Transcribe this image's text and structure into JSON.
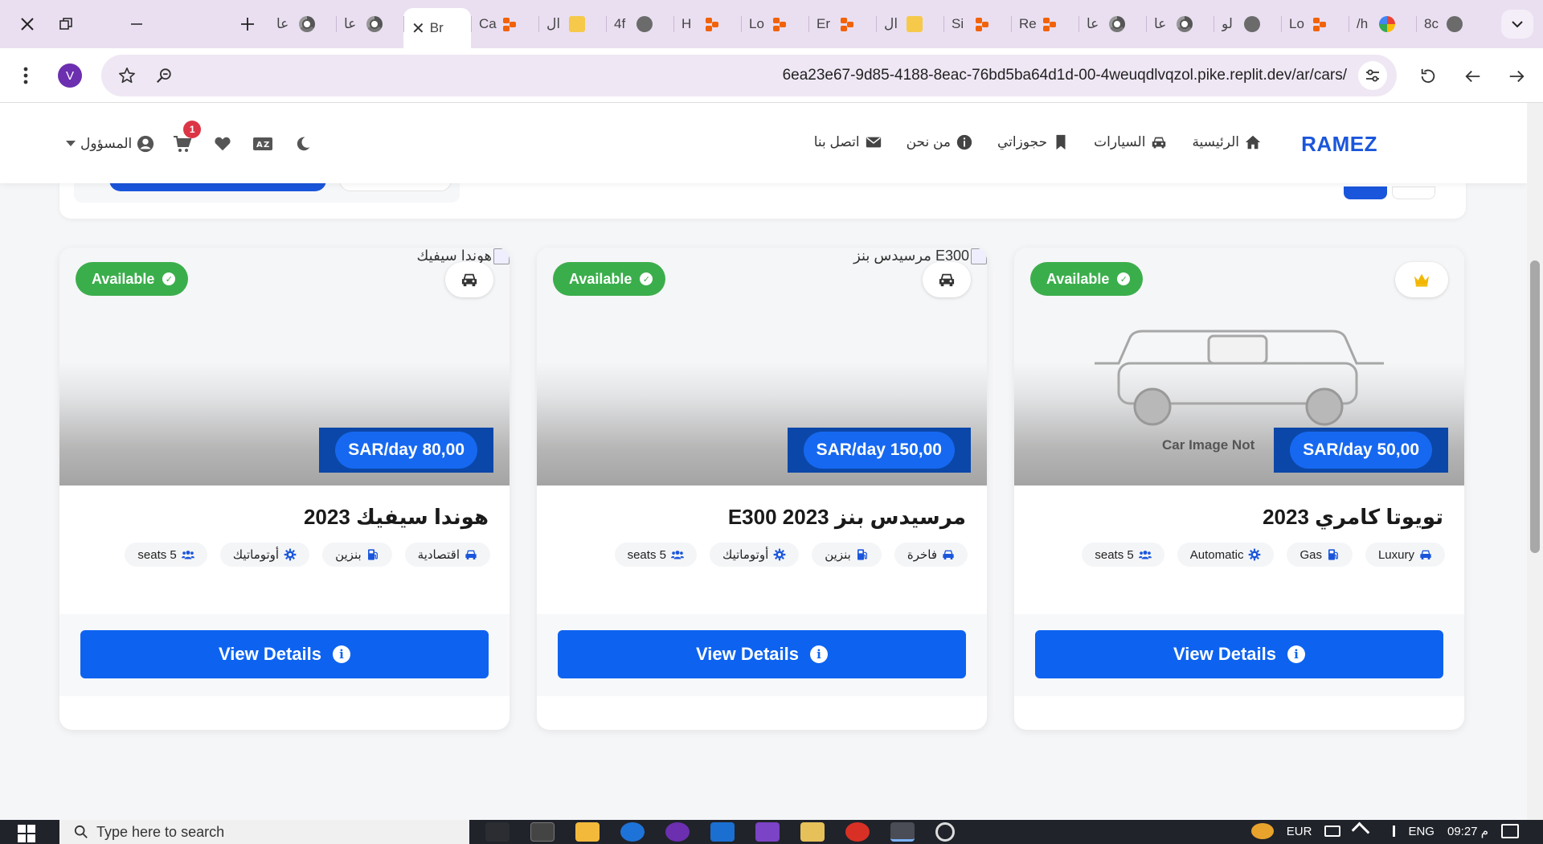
{
  "browser": {
    "tabs": [
      {
        "label": "عا",
        "icon": "chrome-icon",
        "active": false
      },
      {
        "label": "عا",
        "icon": "chrome-icon",
        "active": false
      },
      {
        "label": "Br",
        "icon": "close-icon",
        "active": true
      },
      {
        "label": "Ca",
        "icon": "replit-icon",
        "active": false
      },
      {
        "label": "ال",
        "icon": "mail-icon",
        "active": false
      },
      {
        "label": "4f",
        "icon": "globe-icon",
        "active": false
      },
      {
        "label": "H",
        "icon": "replit-icon",
        "active": false
      },
      {
        "label": "Lo",
        "icon": "replit-icon",
        "active": false
      },
      {
        "label": "Er",
        "icon": "replit-icon",
        "active": false
      },
      {
        "label": "ال",
        "icon": "mail-icon",
        "active": false
      },
      {
        "label": "Si",
        "icon": "replit-icon",
        "active": false
      },
      {
        "label": "Re",
        "icon": "replit-icon",
        "active": false
      },
      {
        "label": "عا",
        "icon": "chrome-icon",
        "active": false
      },
      {
        "label": "عا",
        "icon": "chrome-icon",
        "active": false
      },
      {
        "label": "لو",
        "icon": "globe-icon",
        "active": false
      },
      {
        "label": "Lo",
        "icon": "replit-icon",
        "active": false
      },
      {
        "label": "/h",
        "icon": "google-icon",
        "active": false
      },
      {
        "label": "8c",
        "icon": "globe-icon",
        "active": false
      }
    ],
    "profile_initial": "V",
    "url": "6ea23e67-9d85-4188-8eac-76bd5ba64d1d-00-4weuqdlvqzol.pike.replit.dev/ar/cars/"
  },
  "site": {
    "brand": "RAMEZ",
    "nav": [
      {
        "label": "الرئيسية",
        "icon": "home-icon"
      },
      {
        "label": "السيارات",
        "icon": "car-icon"
      },
      {
        "label": "حجوزاتي",
        "icon": "bookmark-icon"
      },
      {
        "label": "من نحن",
        "icon": "info-circle-icon"
      },
      {
        "label": "اتصل بنا",
        "icon": "envelope-icon"
      }
    ],
    "cart_count": "1",
    "user_label": "المسؤول"
  },
  "cards": [
    {
      "status": "Available",
      "price": "SAR/day 80,00",
      "title": "هوندا سيفيك 2023",
      "image_alt": "هوندا سيفيك",
      "corner_icon": "car-icon",
      "specs": [
        {
          "label": "اقتصادية",
          "icon": "car-icon"
        },
        {
          "label": "بنزين",
          "icon": "fuel-icon"
        },
        {
          "label": "أوتوماتيك",
          "icon": "gear-icon"
        },
        {
          "label": "seats 5",
          "icon": "users-icon"
        }
      ],
      "button": "View Details"
    },
    {
      "status": "Available",
      "price": "SAR/day 150,00",
      "title": "مرسيدس بنز E300 2023",
      "image_alt": "مرسيدس بنز E300",
      "corner_icon": "car-icon",
      "specs": [
        {
          "label": "فاخرة",
          "icon": "car-icon"
        },
        {
          "label": "بنزين",
          "icon": "fuel-icon"
        },
        {
          "label": "أوتوماتيك",
          "icon": "gear-icon"
        },
        {
          "label": "seats 5",
          "icon": "users-icon"
        }
      ],
      "button": "View Details"
    },
    {
      "status": "Available",
      "price": "SAR/day 50,00",
      "title": "تويوتا كامري 2023",
      "image_placeholder": "Car Image Not",
      "corner_icon": "crown-icon",
      "specs": [
        {
          "label": "Luxury",
          "icon": "car-icon"
        },
        {
          "label": "Gas",
          "icon": "fuel-icon"
        },
        {
          "label": "Automatic",
          "icon": "gear-icon"
        },
        {
          "label": "seats 5",
          "icon": "users-icon"
        }
      ],
      "button": "View Details"
    }
  ],
  "taskbar": {
    "search_placeholder": "Type here to search",
    "lang_1": "ENG",
    "lang_2": "EUR",
    "time": "09:27 م"
  },
  "colors": {
    "brand": "#1a56db",
    "available": "#3bae4c",
    "button": "#0d63f0",
    "price_pill": "#1668f0",
    "badge": "#dc3545"
  }
}
